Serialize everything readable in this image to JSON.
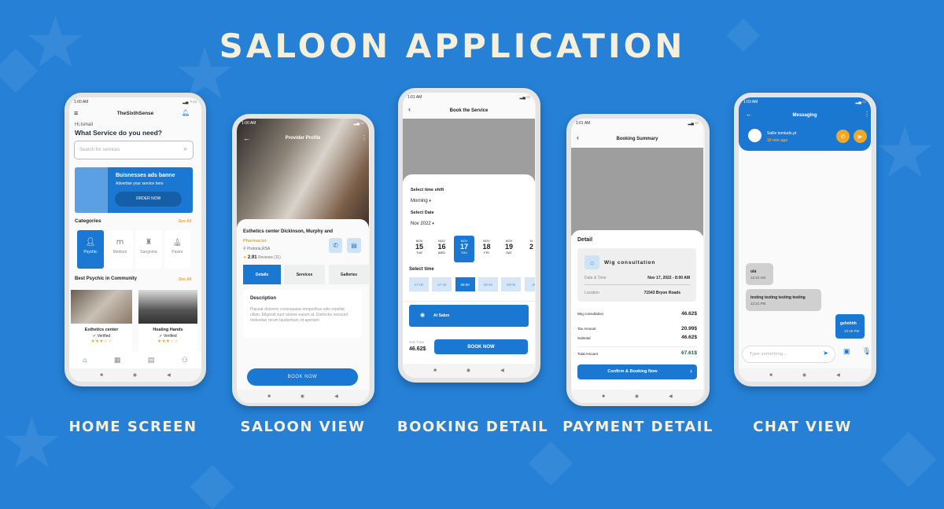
{
  "title": "SALOON APPLICATION",
  "labels": [
    "HOME SCREEN",
    "SALOON VIEW",
    "BOOKING DETAIL",
    "PAYMENT DETAIL",
    "CHAT VIEW"
  ],
  "colors": {
    "background": "#2580d6",
    "accent": "#1a78d2",
    "orange": "#f5a623"
  },
  "home": {
    "status_time": "1:00 AM",
    "app_title": "TheSixthSense",
    "greeting": "Hi,Ismail",
    "question": "What Service do you need?",
    "search_placeholder": "Search for services",
    "banner": {
      "title": "Buisnesses ads banne",
      "subtitle": "Advertise your service here",
      "button": "ORDER NOW"
    },
    "categories_title": "Categories",
    "see_all": "See All",
    "categories": [
      "Psychic",
      "Medium",
      "Sangoma",
      "Pastor"
    ],
    "best_title": "Best Psychic in Community",
    "cards": [
      {
        "name": "Esthetics center",
        "badge": "Verified"
      },
      {
        "name": "Healing Hands",
        "badge": "Verified"
      }
    ],
    "stars": "★★★☆☆"
  },
  "saloon": {
    "status_time": "1:00 AM",
    "header": "Provider Profile",
    "name": "Esthetics center Dickinson, Murphy and",
    "role": "Pharmacist",
    "location": "Pretoria,RSA",
    "rating": "2.91",
    "reviews": "Reviews (11)",
    "tabs": [
      "Details",
      "Services",
      "Galleries"
    ],
    "desc_title": "Description",
    "desc": "Placeat dolorem consequatur temporibus odio repellat ullam. Eligendi sunt ratione earum at. Distinctio nesciunt molestiae rerum laudantium sit aperiam.",
    "book": "BOOK NOW"
  },
  "booking": {
    "status_time": "1:01 AM",
    "header": "Book the Service",
    "shift_label": "Select time shift",
    "shift": "Morning",
    "date_label": "Select Date",
    "month": "Nov 2022",
    "dates": [
      {
        "m": "NOV",
        "d": "15",
        "w": "TUE"
      },
      {
        "m": "NOV",
        "d": "16",
        "w": "WED"
      },
      {
        "m": "NOV",
        "d": "17",
        "w": "THU"
      },
      {
        "m": "NOV",
        "d": "18",
        "w": "FRI"
      },
      {
        "m": "NOV",
        "d": "19",
        "w": "SAT"
      },
      {
        "m": "N",
        "d": "2",
        "w": ""
      }
    ],
    "selected_date": "17",
    "time_label": "Select time",
    "times": [
      "07:00",
      "07:30",
      "08:00",
      "08:30",
      "09:00",
      "09"
    ],
    "selected_time": "08:00",
    "location_option": "At Salon",
    "subtotal_label": "Sub Total",
    "subtotal": "46.62$",
    "book": "BOOK NOW"
  },
  "payment": {
    "status_time": "1:01 AM",
    "header": "Booking Summary",
    "detail": "Detail",
    "service": "Wig consultation",
    "date_label": "Date & Time",
    "date_value": "Nov 17, 2022 - 8:00 AM",
    "loc_label": "Location",
    "loc_value": "71543 Bryon Roads",
    "lines": [
      {
        "k": "Wig consultation",
        "v": "46.62$"
      },
      {
        "k": "Tax Amount",
        "v": "20.99$"
      },
      {
        "k": "Subtotal",
        "v": "46.62$"
      }
    ],
    "total_label": "Total Amount",
    "total": "67.61$",
    "confirm": "Confirm & Booking Now"
  },
  "chat": {
    "status_time": "1:03 AM",
    "header": "Messaging",
    "contact": "Sallie temtudo.pt",
    "last_seen": "10 min ago",
    "messages": [
      {
        "text": "olá",
        "time": "12:22 AM",
        "side": "in"
      },
      {
        "text": "testing testing testing testing",
        "time": "12:21 PM",
        "side": "in"
      },
      {
        "text": "gshshhh",
        "time": "10:48 PM",
        "side": "out"
      }
    ],
    "input_placeholder": "Type something..."
  }
}
